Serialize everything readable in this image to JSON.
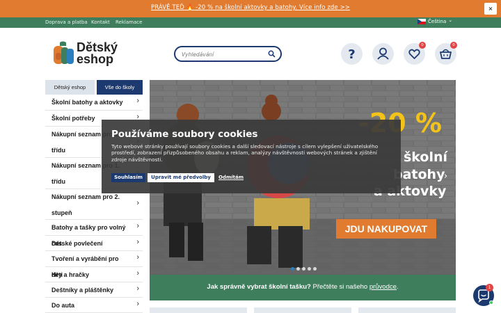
{
  "promo": {
    "text": "PRÁVĚ TEĎ 🔥 -20 % na školní aktovky a batohy. Více info zde >>",
    "close_label": "×"
  },
  "topnav": {
    "links": [
      "Doprava a platba",
      "Kontakt",
      "Reklamace"
    ],
    "language": "Čeština",
    "language_chevron": "⌄"
  },
  "header": {
    "logo_line1": "Dětský",
    "logo_line2": "eshop",
    "search_placeholder": "Vyhledávání",
    "cart_count": "0",
    "wishlist_count": "0"
  },
  "sidebar": {
    "tabs": [
      "Dětský eshop",
      "Vše do školy"
    ],
    "categories": [
      {
        "label": "Školní batohy a aktovky"
      },
      {
        "label": "Školní potřeby"
      },
      {
        "label": "Nákupní seznam pro 1. třídu"
      },
      {
        "label": "Nákupní seznam pro 1. třídu"
      },
      {
        "label": "Nákupní seznam pro 2. stupeň"
      },
      {
        "label": "Batohy a tašky pro volný čas"
      },
      {
        "label": "Dětské povlečení"
      },
      {
        "label": "Tvoření a vyrábění pro děti"
      },
      {
        "label": "Hry a hračky"
      },
      {
        "label": "Deštníky a pláštěnky"
      },
      {
        "label": "Do auta"
      }
    ],
    "chevron": "›"
  },
  "banner": {
    "headline_percent": "-20 %",
    "headline_line1": "školní",
    "headline_line2": "batohy",
    "headline_line3": "a aktovky",
    "cta": "JDU NAKUPOVAT",
    "next_arrow": "›",
    "active_slide": 1,
    "slide_count": 5,
    "bar_bold": "Jak správně vybrat školní tašku?",
    "bar_text": " Přečtěte si našeho ",
    "bar_link": "průvodce",
    "bar_end": "."
  },
  "cookie": {
    "title": "Používáme soubory cookies",
    "text": "Tyto webové stránky používají soubory cookies a další sledovací nástroje s cílem vylepšení uživatelského prostředí, zobrazení přizpůsobeného obsahu a reklam, analýzy návštěvnosti webových stránek a zjištění zdroje návštěvnosti.",
    "accept": "Souhlasím",
    "customize": "Upravit mé předvolby",
    "reject": "Odmítám"
  },
  "chat": {
    "badge": "1"
  },
  "colors": {
    "promo": "#e07b2f",
    "green": "#3f7e5d",
    "navy": "#1c3a70",
    "badge": "#e04646"
  }
}
